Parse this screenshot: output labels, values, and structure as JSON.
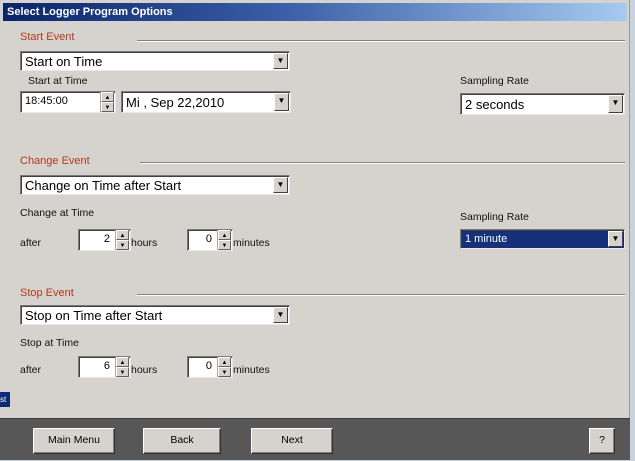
{
  "window": {
    "title": "Select Logger Program Options"
  },
  "start": {
    "group_label": "Start Event",
    "event_value": "Start on Time",
    "time_label": "Start at Time",
    "time_value": "18:45:00",
    "date_value": "Mi , Sep 22,2010",
    "sampling_label": "Sampling Rate",
    "sampling_value": "2 seconds"
  },
  "change": {
    "group_label": "Change Event",
    "event_value": "Change on Time after Start",
    "time_label": "Change at Time",
    "after_label": "after",
    "hours_value": "2",
    "hours_label": "hours",
    "minutes_value": "0",
    "minutes_label": "minutes",
    "sampling_label": "Sampling Rate",
    "sampling_value": "1 minute"
  },
  "stop": {
    "group_label": "Stop Event",
    "event_value": "Stop on Time after Start",
    "time_label": "Stop at Time",
    "after_label": "after",
    "hours_value": "6",
    "hours_label": "hours",
    "minutes_value": "0",
    "minutes_label": "minutes"
  },
  "buttons": {
    "main_menu": "Main Menu",
    "back": "Back",
    "next": "Next",
    "help": "?"
  },
  "side_tab": "st",
  "colors": {
    "titlebar": "#0a246a",
    "group_label": "#b13a1e",
    "selected": "#16307a",
    "bottom_bar": "#575757"
  }
}
